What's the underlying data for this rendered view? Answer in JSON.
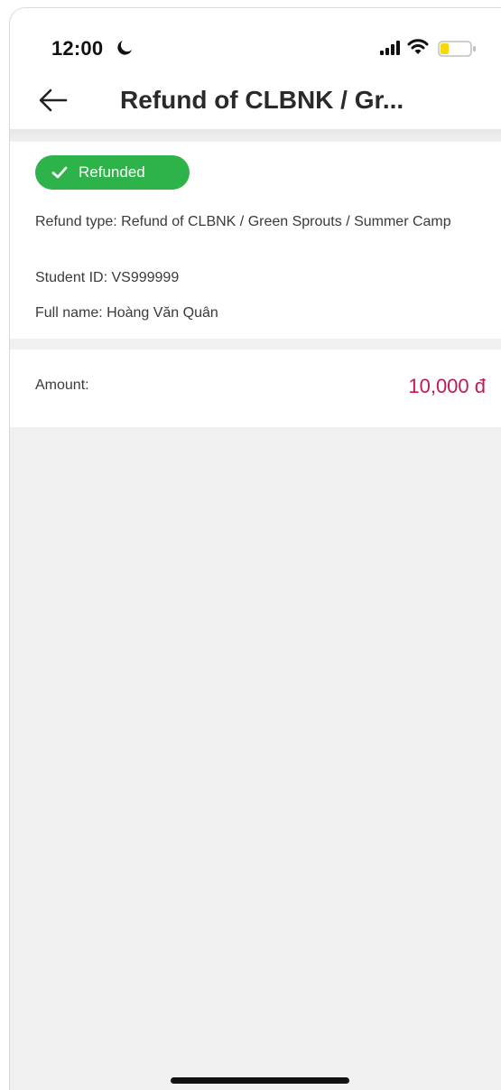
{
  "status_bar": {
    "time": "12:00"
  },
  "header": {
    "title": "Refund of CLBNK / Gr..."
  },
  "details": {
    "status_label": "Refunded",
    "refund_type": "Refund of CLBNK / Green Sprouts / Summer Camp",
    "refund_type_label": "Refund type: Refund of CLBNK / Green Sprouts / Summer Camp",
    "student_id_label": "Student ID: VS999999",
    "full_name_label": "Full name: Hoàng Văn Quân"
  },
  "amount": {
    "label": "Amount:",
    "value": "10,000 đ"
  },
  "colors": {
    "status_green": "#2db34a",
    "amount_pink": "#c2185b",
    "battery_yellow": "#f5d90a"
  },
  "icons": [
    "moon-icon",
    "signal-icon",
    "wifi-icon",
    "battery-icon",
    "back-arrow-icon",
    "check-icon"
  ]
}
